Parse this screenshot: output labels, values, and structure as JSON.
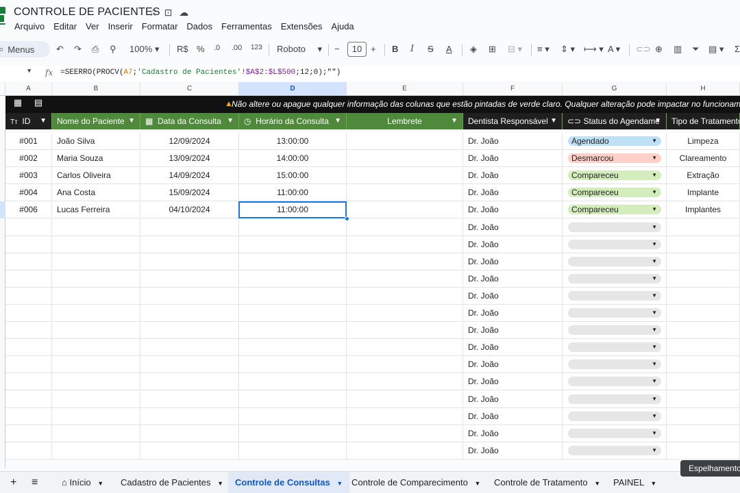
{
  "doc": {
    "title": "CONTROLE DE PACIENTES",
    "menu": [
      "Arquivo",
      "Editar",
      "Ver",
      "Inserir",
      "Formatar",
      "Dados",
      "Ferramentas",
      "Extensões",
      "Ajuda"
    ]
  },
  "toolbar": {
    "search_label": "Menus",
    "zoom": "100%",
    "currency": "R$",
    "percent": "%",
    "dec_less": ".0",
    "dec_more": ".00",
    "number_format": "123",
    "font": "Roboto",
    "font_size": "10"
  },
  "formula": {
    "fx": "fx",
    "p1": "=SEERRO(PROCV(",
    "ref1": "A7",
    "p2": ";",
    "str": "'Cadastro de Pacientes'",
    "ref2": "!$A$2:$L$500",
    "p3": ";12;0);\"\")"
  },
  "columns": [
    "A",
    "B",
    "C",
    "D",
    "E",
    "F",
    "G",
    "H"
  ],
  "banner": "Não altere ou apague qualquer informação das colunas que estão pintadas de verde claro. Qualquer alteração pode impactar no funcionamento da p",
  "headers": {
    "id": "ID",
    "id_icon": "Tт",
    "nome": "Nome do Paciente",
    "data": "Data da Consulta",
    "horario": "Horário da Consulta",
    "lembrete": "Lembrete",
    "dentista": "Dentista Responsável",
    "status": "Status do Agendame",
    "tipo": "Tipo de Tratamento"
  },
  "rows": [
    {
      "id": "#001",
      "nome": "João Silva",
      "data": "12/09/2024",
      "hora": "13:00:00",
      "dentista": "Dr. João",
      "status": "Agendado",
      "tipo": "Limpeza"
    },
    {
      "id": "#002",
      "nome": "Maria Souza",
      "data": "13/09/2024",
      "hora": "14:00:00",
      "dentista": "Dr. João",
      "status": "Desmarcou",
      "tipo": "Clareamento"
    },
    {
      "id": "#003",
      "nome": "Carlos Oliveira",
      "data": "14/09/2024",
      "hora": "15:00:00",
      "dentista": "Dr. João",
      "status": "Compareceu",
      "tipo": "Extração"
    },
    {
      "id": "#004",
      "nome": "Ana Costa",
      "data": "15/09/2024",
      "hora": "11:00:00",
      "dentista": "Dr. João",
      "status": "Compareceu",
      "tipo": "Implante"
    },
    {
      "id": "#006",
      "nome": "Lucas Ferreira",
      "data": "04/10/2024",
      "hora": "11:00:00",
      "dentista": "Dr. João",
      "status": "Compareceu",
      "tipo": "Implantes"
    }
  ],
  "empty_dentista": "Dr. João",
  "empty_row_count": 14,
  "status_colors": {
    "Agendado": "#bfe1f6",
    "Desmarcou": "#ffcfc9",
    "Compareceu": "#d4edbc",
    "empty": "#e6e6e6"
  },
  "tabs": [
    "Início",
    "Cadastro de Pacientes",
    "Controle de Consultas",
    "Controle de Comparecimento",
    "Controle de Tratamento",
    "PAINEL"
  ],
  "active_tab": "Controle de Consultas",
  "tooltip": "Espelhamento"
}
